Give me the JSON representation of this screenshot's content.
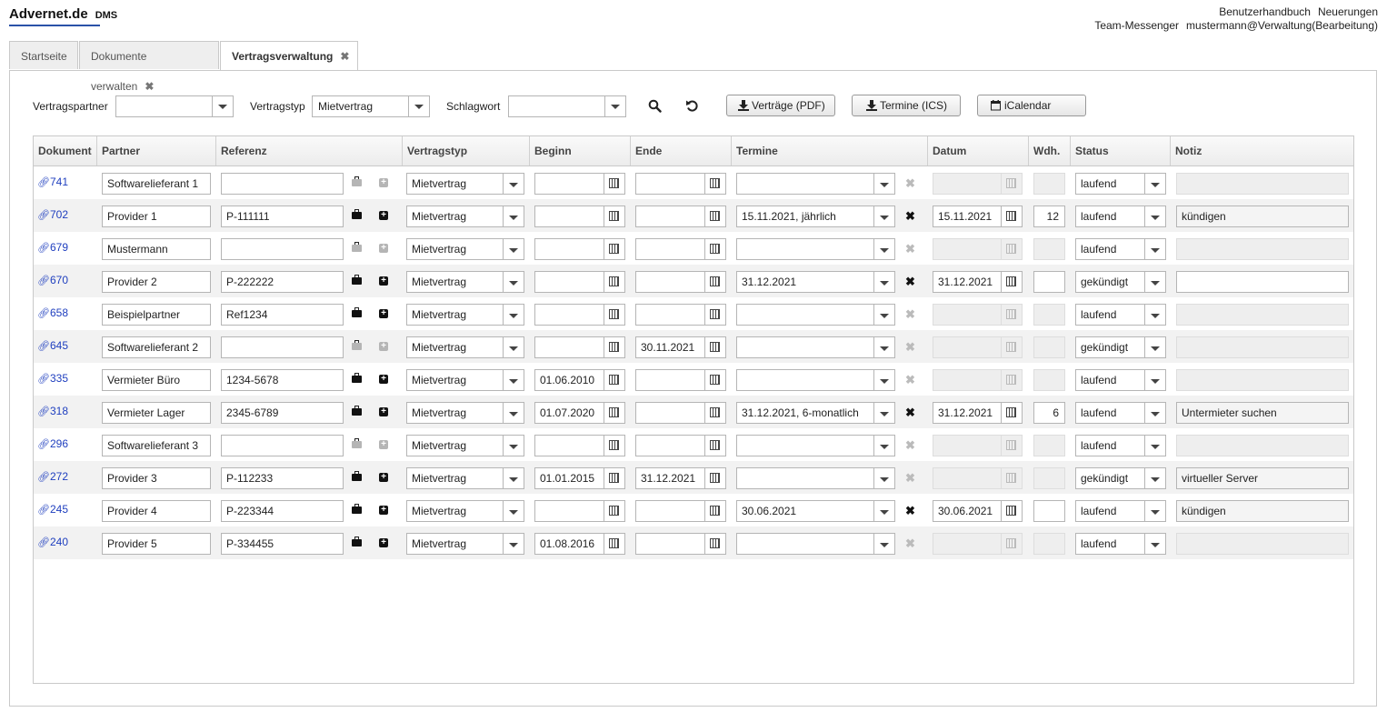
{
  "app": {
    "logo": "Advernet.de",
    "product": "DMS"
  },
  "toplinks": [
    "Benutzerhandbuch",
    "Neuerungen",
    "Team-Messenger",
    "mustermann@Verwaltung(Bearbeitung)"
  ],
  "tabs": [
    {
      "label": "Startseite"
    },
    {
      "label": "Dokumente verwalten",
      "close": "✖"
    },
    {
      "label": "Vertragsverwaltung",
      "close": "✖"
    }
  ],
  "filters": {
    "partner_label": "Vertragspartner",
    "partner_value": "",
    "type_label": "Vertragstyp",
    "type_value": "Mietvertrag",
    "keyword_label": "Schlagwort",
    "keyword_value": ""
  },
  "buttons": {
    "pdf": "Verträge (PDF)",
    "ics": "Termine (ICS)",
    "ical": "iCalendar"
  },
  "columns": [
    "Dokument",
    "Partner",
    "Referenz",
    "Vertragstyp",
    "Beginn",
    "Ende",
    "Termine",
    "Datum",
    "Wdh.",
    "Status",
    "Notiz"
  ],
  "rows": [
    {
      "doc": "741",
      "partner": "Softwarelieferant 1",
      "ref": "",
      "type": "Mietvertrag",
      "begin": "",
      "end": "",
      "termine": "",
      "datum": "",
      "wdh": "",
      "status": "laufend",
      "notiz": ""
    },
    {
      "doc": "702",
      "partner": "Provider 1",
      "ref": "P-111111",
      "type": "Mietvertrag",
      "begin": "",
      "end": "",
      "termine": "15.11.2021, jährlich",
      "datum": "15.11.2021",
      "wdh": "12",
      "status": "laufend",
      "notiz": "kündigen"
    },
    {
      "doc": "679",
      "partner": "Mustermann",
      "ref": "",
      "type": "Mietvertrag",
      "begin": "",
      "end": "",
      "termine": "",
      "datum": "",
      "wdh": "",
      "status": "laufend",
      "notiz": ""
    },
    {
      "doc": "670",
      "partner": "Provider 2",
      "ref": "P-222222",
      "type": "Mietvertrag",
      "begin": "",
      "end": "",
      "termine": "31.12.2021",
      "datum": "31.12.2021",
      "wdh": "",
      "status": "gekündigt",
      "notiz": ""
    },
    {
      "doc": "658",
      "partner": "Beispielpartner",
      "ref": "Ref1234",
      "type": "Mietvertrag",
      "begin": "",
      "end": "",
      "termine": "",
      "datum": "",
      "wdh": "",
      "status": "laufend",
      "notiz": ""
    },
    {
      "doc": "645",
      "partner": "Softwarelieferant 2",
      "ref": "",
      "type": "Mietvertrag",
      "begin": "",
      "end": "30.11.2021",
      "termine": "",
      "datum": "",
      "wdh": "",
      "status": "gekündigt",
      "notiz": ""
    },
    {
      "doc": "335",
      "partner": "Vermieter Büro",
      "ref": "1234-5678",
      "type": "Mietvertrag",
      "begin": "01.06.2010",
      "end": "",
      "termine": "",
      "datum": "",
      "wdh": "",
      "status": "laufend",
      "notiz": ""
    },
    {
      "doc": "318",
      "partner": "Vermieter Lager",
      "ref": "2345-6789",
      "type": "Mietvertrag",
      "begin": "01.07.2020",
      "end": "",
      "termine": "31.12.2021, 6-monatlich",
      "datum": "31.12.2021",
      "wdh": "6",
      "status": "laufend",
      "notiz": "Untermieter suchen"
    },
    {
      "doc": "296",
      "partner": "Softwarelieferant 3",
      "ref": "",
      "type": "Mietvertrag",
      "begin": "",
      "end": "",
      "termine": "",
      "datum": "",
      "wdh": "",
      "status": "laufend",
      "notiz": ""
    },
    {
      "doc": "272",
      "partner": "Provider 3",
      "ref": "P-112233",
      "type": "Mietvertrag",
      "begin": "01.01.2015",
      "end": "31.12.2021",
      "termine": "",
      "datum": "",
      "wdh": "",
      "status": "gekündigt",
      "notiz": "virtueller Server"
    },
    {
      "doc": "245",
      "partner": "Provider 4",
      "ref": "P-223344",
      "type": "Mietvertrag",
      "begin": "",
      "end": "",
      "termine": "30.06.2021",
      "datum": "30.06.2021",
      "wdh": "",
      "status": "laufend",
      "notiz": "kündigen"
    },
    {
      "doc": "240",
      "partner": "Provider 5",
      "ref": "P-334455",
      "type": "Mietvertrag",
      "begin": "01.08.2016",
      "end": "",
      "termine": "",
      "datum": "",
      "wdh": "",
      "status": "laufend",
      "notiz": ""
    }
  ],
  "colors": {
    "link": "#1f3fbf",
    "logo_underline": "#2a52a8",
    "row_alt": "#f2f2f2"
  }
}
